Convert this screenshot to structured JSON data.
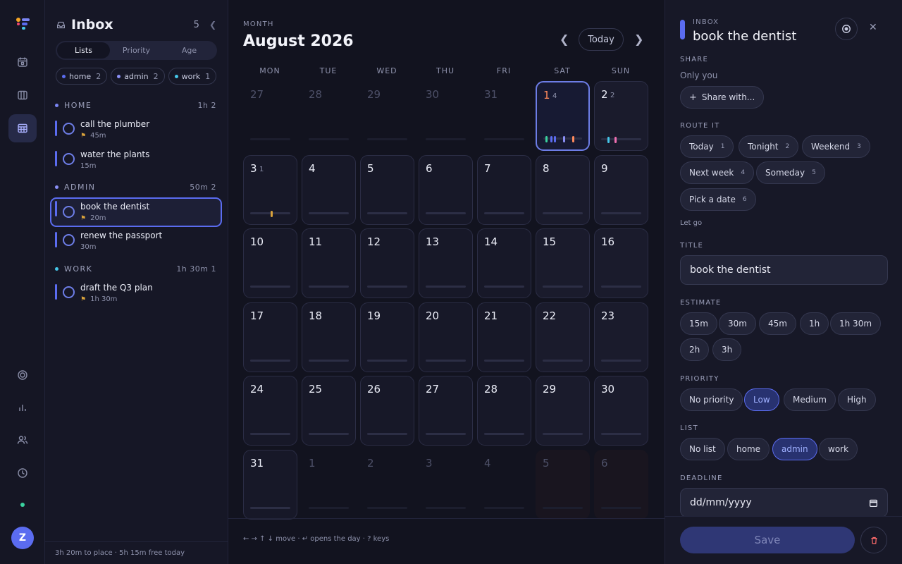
{
  "rail": {
    "avatar_initial": "Z"
  },
  "sidebar": {
    "title": "Inbox",
    "count": "5",
    "segments": [
      {
        "label": "Lists",
        "active": true
      },
      {
        "label": "Priority",
        "active": false
      },
      {
        "label": "Age",
        "active": false
      }
    ],
    "chips": [
      {
        "label": "home",
        "count": "2",
        "color": "#5b6cf0"
      },
      {
        "label": "admin",
        "count": "2",
        "color": "#8a8ff5"
      },
      {
        "label": "work",
        "count": "1",
        "color": "#45c6e8"
      }
    ],
    "groups": [
      {
        "name": "HOME",
        "meta": "1h  2",
        "color": "#7b86f5",
        "tasks": [
          {
            "title": "call the plumber",
            "sub": "45m",
            "flag": true
          },
          {
            "title": "water the plants",
            "sub": "15m",
            "flag": false
          }
        ]
      },
      {
        "name": "ADMIN",
        "meta": "50m  2",
        "color": "#8a8ff5",
        "tasks": [
          {
            "title": "book the dentist",
            "sub": "20m",
            "flag": true
          },
          {
            "title": "renew the passport",
            "sub": "30m",
            "flag": false
          }
        ]
      },
      {
        "name": "WORK",
        "meta": "1h 30m  1",
        "color": "#45c6e8",
        "tasks": [
          {
            "title": "draft the Q3 plan",
            "sub": "1h 30m",
            "flag": true
          }
        ]
      }
    ],
    "footer": "3h 20m to place · 5h 15m free today"
  },
  "calendar": {
    "label": "MONTH",
    "title": "August 2026",
    "today_label": "Today",
    "weekdays": [
      "MON",
      "TUE",
      "WED",
      "THU",
      "FRI",
      "SAT",
      "SUN"
    ],
    "days": [
      {
        "n": "27",
        "out": true
      },
      {
        "n": "28",
        "out": true
      },
      {
        "n": "29",
        "out": true
      },
      {
        "n": "30",
        "out": true
      },
      {
        "n": "31",
        "out": true
      },
      {
        "n": "1",
        "count": "4",
        "today": true
      },
      {
        "n": "2",
        "count": "2"
      },
      {
        "n": "3",
        "count": "1"
      },
      {
        "n": "4"
      },
      {
        "n": "5"
      },
      {
        "n": "6"
      },
      {
        "n": "7"
      },
      {
        "n": "8"
      },
      {
        "n": "9"
      },
      {
        "n": "10"
      },
      {
        "n": "11"
      },
      {
        "n": "12"
      },
      {
        "n": "13"
      },
      {
        "n": "14"
      },
      {
        "n": "15"
      },
      {
        "n": "16"
      },
      {
        "n": "17"
      },
      {
        "n": "18"
      },
      {
        "n": "19"
      },
      {
        "n": "20"
      },
      {
        "n": "21"
      },
      {
        "n": "22"
      },
      {
        "n": "23"
      },
      {
        "n": "24"
      },
      {
        "n": "25"
      },
      {
        "n": "26"
      },
      {
        "n": "27"
      },
      {
        "n": "28"
      },
      {
        "n": "29"
      },
      {
        "n": "30"
      },
      {
        "n": "31"
      },
      {
        "n": "1",
        "out": true
      },
      {
        "n": "2",
        "out": true
      },
      {
        "n": "3",
        "out": true
      },
      {
        "n": "4",
        "out": true
      },
      {
        "n": "5",
        "out": true
      },
      {
        "n": "6",
        "out": true
      }
    ],
    "footer": "← → ↑ ↓ move · ↵ opens the day · ? keys"
  },
  "detail": {
    "list_label": "INBOX",
    "title": "book the dentist",
    "share_label": "SHARE",
    "share_value": "Only you",
    "share_button": "Share with...",
    "route_label": "ROUTE IT",
    "routes": [
      {
        "label": "Today",
        "n": "1"
      },
      {
        "label": "Tonight",
        "n": "2"
      },
      {
        "label": "Weekend",
        "n": "3"
      },
      {
        "label": "Next week",
        "n": "4"
      },
      {
        "label": "Someday",
        "n": "5"
      },
      {
        "label": "Pick a date",
        "n": "6"
      }
    ],
    "let_go": "Let go",
    "title_label": "TITLE",
    "title_value": "book the dentist",
    "estimate_label": "ESTIMATE",
    "estimates": [
      "15m",
      "30m",
      "45m",
      "1h",
      "1h 30m",
      "2h",
      "3h"
    ],
    "priority_label": "PRIORITY",
    "priorities": [
      {
        "label": "No priority"
      },
      {
        "label": "Low",
        "on": true
      },
      {
        "label": "Medium"
      },
      {
        "label": "High"
      }
    ],
    "list_field_label": "LIST",
    "lists": [
      {
        "label": "No list"
      },
      {
        "label": "home"
      },
      {
        "label": "admin",
        "on": true
      },
      {
        "label": "work"
      }
    ],
    "deadline_label": "DEADLINE",
    "deadline_placeholder": "dd/mm/yyyy",
    "save": "Save"
  }
}
